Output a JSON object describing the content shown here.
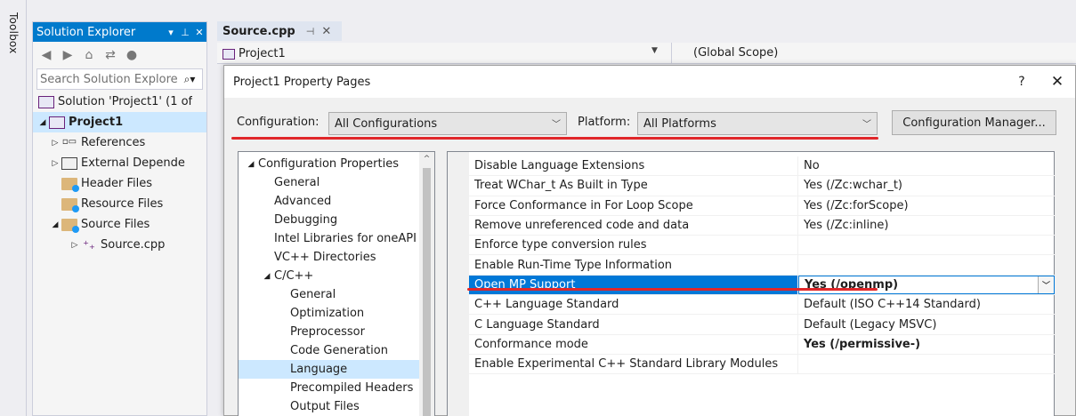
{
  "toolbox": {
    "label": "Toolbox"
  },
  "solution_explorer": {
    "title": "Solution Explorer",
    "search_placeholder": "Search Solution Explore",
    "tree": [
      {
        "label": "Solution 'Project1' (1 of",
        "icon": "solution-icon",
        "arrow": "",
        "bold": false
      },
      {
        "label": "Project1",
        "icon": "project-icon",
        "arrow": "◢",
        "bold": true
      },
      {
        "label": "References",
        "icon": "references-icon",
        "arrow": "▷"
      },
      {
        "label": "External Depende",
        "icon": "external-dependencies-icon",
        "arrow": "▷"
      },
      {
        "label": "Header Files",
        "icon": "folder-icon",
        "arrow": ""
      },
      {
        "label": "Resource Files",
        "icon": "folder-icon",
        "arrow": ""
      },
      {
        "label": "Source Files",
        "icon": "folder-icon",
        "arrow": "◢"
      },
      {
        "label": "Source.cpp",
        "icon": "cpp-file-icon",
        "arrow": "▷"
      }
    ]
  },
  "editor": {
    "tab_label": "Source.cpp",
    "nav_project": "Project1",
    "nav_scope": "(Global Scope)"
  },
  "dialog": {
    "title": "Project1 Property Pages",
    "help": "?",
    "close": "✕",
    "configuration_label": "Configuration:",
    "configuration_value": "All Configurations",
    "platform_label": "Platform:",
    "platform_value": "All Platforms",
    "config_manager_label": "Configuration Manager...",
    "tree": [
      {
        "label": "Configuration Properties",
        "indent": 0,
        "arrow": "◢"
      },
      {
        "label": "General",
        "indent": 1
      },
      {
        "label": "Advanced",
        "indent": 1
      },
      {
        "label": "Debugging",
        "indent": 1
      },
      {
        "label": "Intel Libraries for oneAPI",
        "indent": 1
      },
      {
        "label": "VC++ Directories",
        "indent": 1
      },
      {
        "label": "C/C++",
        "indent": 1,
        "arrow": "◢"
      },
      {
        "label": "General",
        "indent": 2
      },
      {
        "label": "Optimization",
        "indent": 2
      },
      {
        "label": "Preprocessor",
        "indent": 2
      },
      {
        "label": "Code Generation",
        "indent": 2
      },
      {
        "label": "Language",
        "indent": 2,
        "selected": true
      },
      {
        "label": "Precompiled Headers",
        "indent": 2
      },
      {
        "label": "Output Files",
        "indent": 2
      }
    ],
    "properties": [
      {
        "name": "Disable Language Extensions",
        "value": "No"
      },
      {
        "name": "Treat WChar_t As Built in Type",
        "value": "Yes (/Zc:wchar_t)"
      },
      {
        "name": "Force Conformance in For Loop Scope",
        "value": "Yes (/Zc:forScope)"
      },
      {
        "name": "Remove unreferenced code and data",
        "value": "Yes (/Zc:inline)"
      },
      {
        "name": "Enforce type conversion rules",
        "value": ""
      },
      {
        "name": "Enable Run-Time Type Information",
        "value": ""
      },
      {
        "name": "Open MP Support",
        "value": "Yes (/openmp)",
        "selected": true
      },
      {
        "name": "C++ Language Standard",
        "value": "Default (ISO C++14 Standard)"
      },
      {
        "name": "C Language Standard",
        "value": "Default (Legacy MSVC)"
      },
      {
        "name": "Conformance mode",
        "value": "Yes (/permissive-)",
        "bold": true
      },
      {
        "name": "Enable Experimental C++ Standard Library Modules",
        "value": ""
      }
    ]
  }
}
